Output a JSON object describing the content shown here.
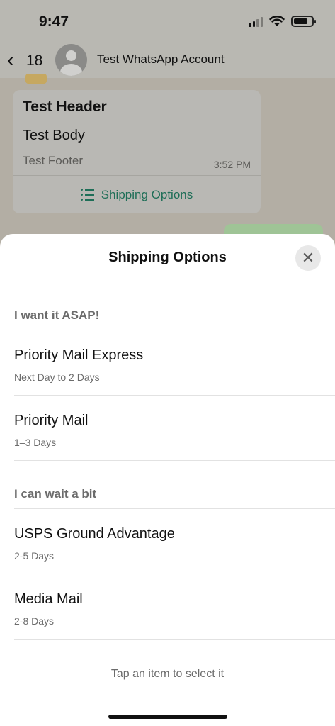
{
  "status_bar": {
    "time": "9:47"
  },
  "chat_header": {
    "back_count": "18",
    "contact_name": "Test WhatsApp Account"
  },
  "message": {
    "header": "Test Header",
    "body": "Test Body",
    "footer": "Test Footer",
    "time": "3:52 PM",
    "action_label": "Shipping Options"
  },
  "sheet": {
    "title": "Shipping Options",
    "sections": [
      {
        "title": "I want it ASAP!",
        "items": [
          {
            "title": "Priority Mail Express",
            "description": "Next Day to 2 Days"
          },
          {
            "title": "Priority Mail",
            "description": "1–3 Days"
          }
        ]
      },
      {
        "title": "I can wait a bit",
        "items": [
          {
            "title": "USPS Ground Advantage",
            "description": "2-5 Days"
          },
          {
            "title": "Media Mail",
            "description": "2-8 Days"
          }
        ]
      }
    ],
    "hint": "Tap an item to select it"
  },
  "colors": {
    "accent": "#1e6e57",
    "dimmed_background": "#b9b8b2",
    "secondary_text": "#6b6b6b"
  },
  "icons": [
    "back-chevron-icon",
    "avatar-icon",
    "signal-icon",
    "wifi-icon",
    "battery-icon",
    "list-icon",
    "close-icon"
  ]
}
